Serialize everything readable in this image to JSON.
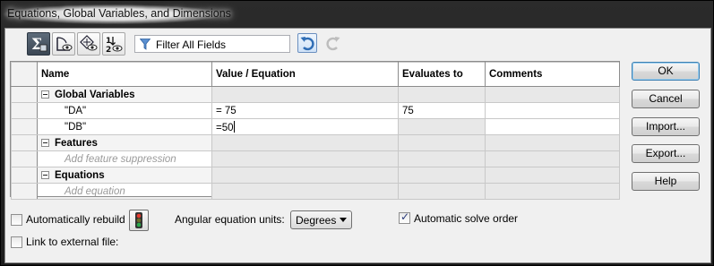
{
  "window": {
    "title": "Equations, Global Variables, and Dimensions"
  },
  "toolbar": {
    "buttons": [
      {
        "icon": "equation-view-icon",
        "pressed": true
      },
      {
        "icon": "sketch-equation-view-icon",
        "pressed": false
      },
      {
        "icon": "dimension-view-icon",
        "pressed": false
      },
      {
        "icon": "ordered-view-icon",
        "pressed": false
      }
    ],
    "filter_placeholder": "Filter All Fields"
  },
  "table": {
    "columns": [
      "Name",
      "Value / Equation",
      "Evaluates to",
      "Comments"
    ],
    "groups": [
      {
        "label": "Global Variables",
        "rows": [
          {
            "name": "\"DA\"",
            "value": "= 75",
            "evaluates": "75",
            "comments": ""
          },
          {
            "name": "\"DB\"",
            "value": "=50",
            "evaluates": "",
            "comments": ""
          }
        ]
      },
      {
        "label": "Features",
        "add_text": "Add feature suppression"
      },
      {
        "label": "Equations",
        "add_text": "Add equation"
      }
    ]
  },
  "buttons": {
    "ok": "OK",
    "cancel": "Cancel",
    "import": "Import...",
    "export": "Export...",
    "help": "Help"
  },
  "options": {
    "auto_rebuild": "Automatically rebuild",
    "auto_rebuild_checked": false,
    "link_external": "Link to external file:",
    "link_external_checked": false,
    "angular_units_label": "Angular equation units:",
    "angular_units_value": "Degrees",
    "auto_solve": "Automatic solve order",
    "auto_solve_checked": true
  }
}
